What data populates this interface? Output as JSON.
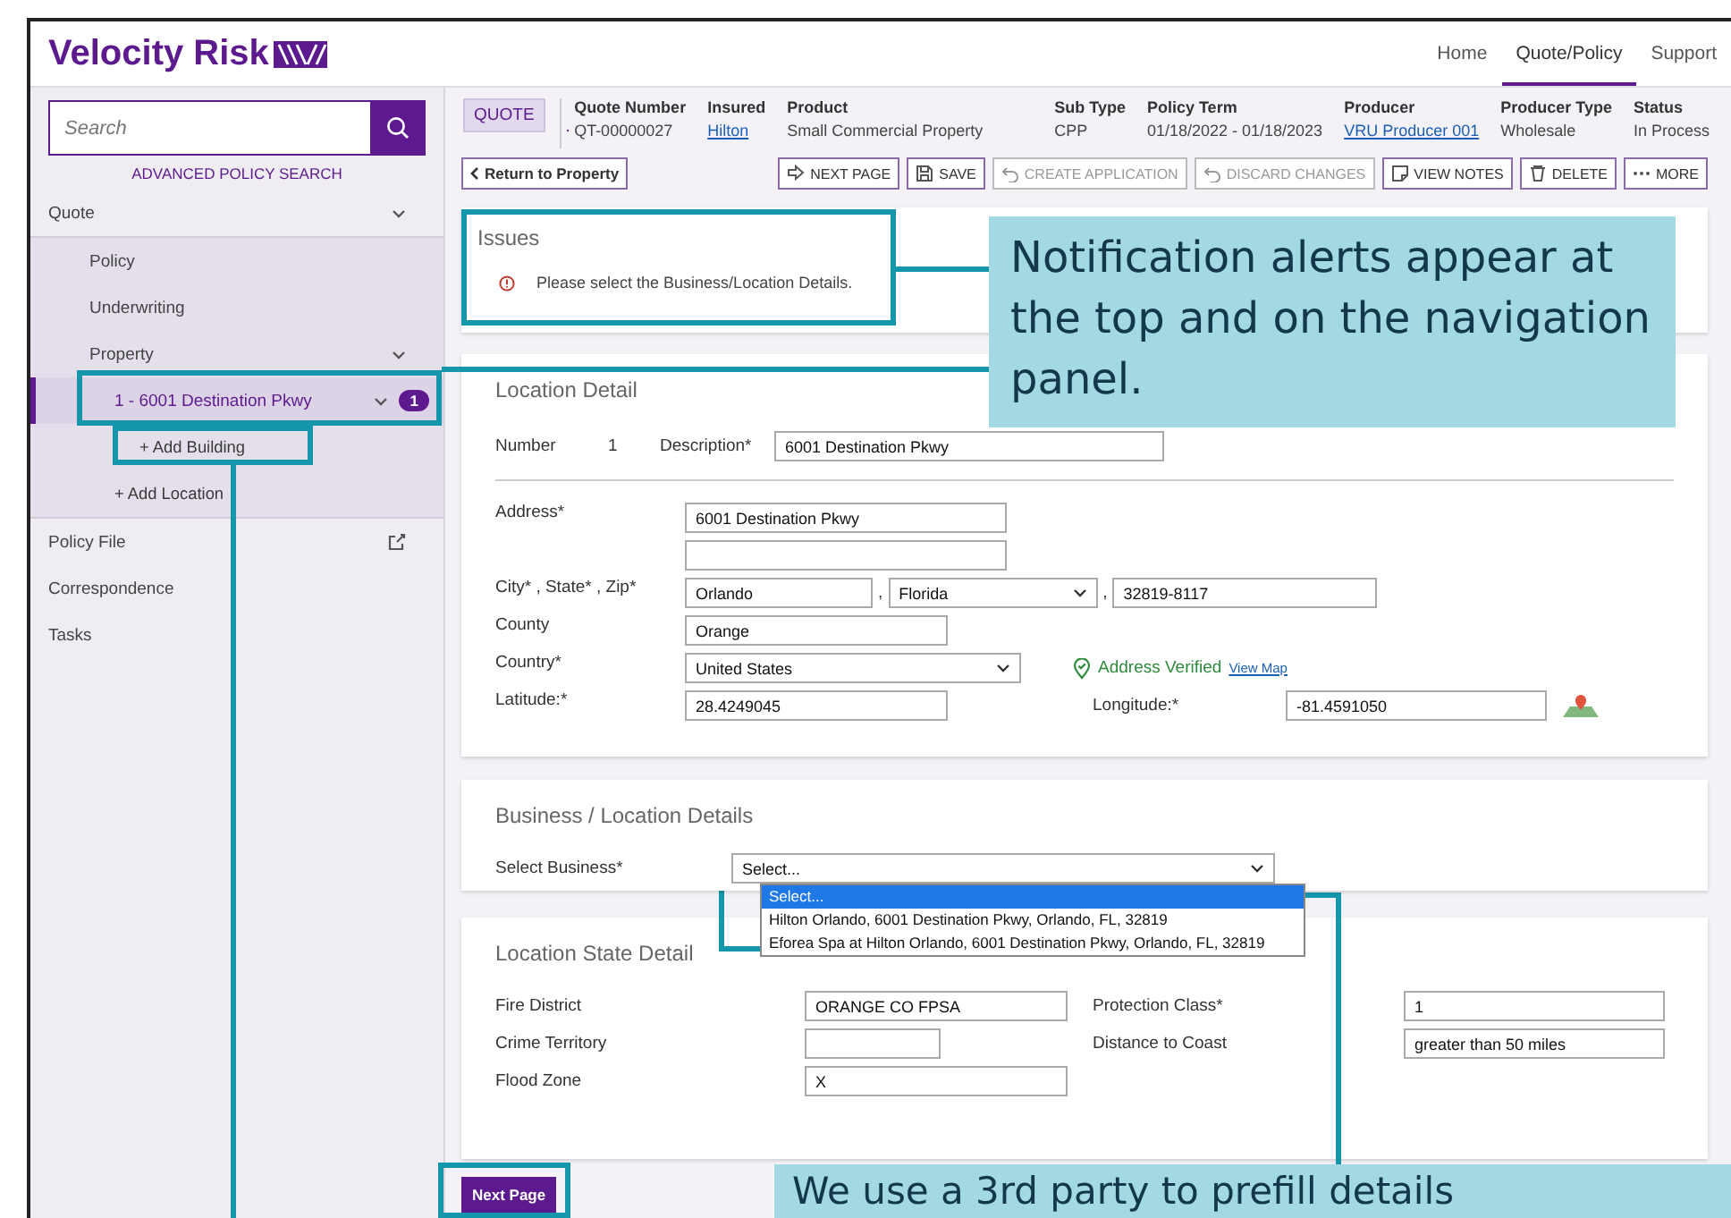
{
  "header": {
    "logo": "Velocity Risk",
    "nav": [
      {
        "label": "Home",
        "selected": false
      },
      {
        "label": "Quote/Policy",
        "selected": true
      },
      {
        "label": "Support",
        "selected": false
      }
    ]
  },
  "sidebar": {
    "search": {
      "placeholder": "Search"
    },
    "advanced_search": "ADVANCED POLICY SEARCH",
    "items": [
      {
        "label": "Quote",
        "kind": "group",
        "expanded": true,
        "selected": false,
        "children": [
          {
            "label": "Policy",
            "kind": "link",
            "selected": false
          },
          {
            "label": "Underwriting",
            "kind": "link",
            "selected": false
          },
          {
            "label": "Property",
            "kind": "group",
            "expanded": true,
            "selected": false,
            "children": [
              {
                "label": "1 - 6001 Destination Pkwy",
                "kind": "group",
                "expanded": true,
                "selected": true,
                "badge": "1",
                "children": [
                  {
                    "label": "+ Add Building",
                    "kind": "add",
                    "selected": false
                  }
                ]
              },
              {
                "label": "+ Add Location",
                "kind": "add",
                "selected": false
              }
            ]
          }
        ]
      },
      {
        "label": "Policy File",
        "kind": "external",
        "selected": false
      },
      {
        "label": "Correspondence",
        "kind": "link",
        "selected": false
      },
      {
        "label": "Tasks",
        "kind": "link",
        "selected": false
      }
    ]
  },
  "quote_bar": {
    "badge": "QUOTE",
    "fields": [
      {
        "label": "Quote Number",
        "value": "QT-00000027",
        "link": false
      },
      {
        "label": "Insured",
        "value": "Hilton",
        "link": true
      },
      {
        "label": "Product",
        "value": "Small Commercial Property",
        "link": false
      },
      {
        "label": "Sub Type",
        "value": "CPP",
        "link": false
      },
      {
        "label": "Policy Term",
        "value": "01/18/2022 - 01/18/2023",
        "link": false
      },
      {
        "label": "Producer",
        "value": "VRU Producer 001",
        "link": true
      },
      {
        "label": "Producer Type",
        "value": "Wholesale",
        "link": false
      },
      {
        "label": "Status",
        "value": "In Process",
        "link": false
      }
    ]
  },
  "toolbar": {
    "back": "Return to Property",
    "actions": [
      {
        "label": "NEXT PAGE",
        "kind": "arrow",
        "disabled": false
      },
      {
        "label": "SAVE",
        "kind": "disk",
        "disabled": false
      },
      {
        "label": "CREATE APPLICATION",
        "kind": "undo",
        "disabled": true
      },
      {
        "label": "DISCARD CHANGES",
        "kind": "undo",
        "disabled": true
      },
      {
        "label": "VIEW NOTES",
        "kind": "note",
        "disabled": false
      },
      {
        "label": "DELETE",
        "kind": "trash",
        "disabled": false
      },
      {
        "label": "MORE",
        "kind": "dots",
        "disabled": false
      }
    ]
  },
  "issues": {
    "title": "Issues",
    "messages": [
      "Please select the Business/Location Details."
    ]
  },
  "location_detail": {
    "title": "Location Detail",
    "number_label": "Number",
    "number": "1",
    "description_label": "Description*",
    "description": "6001 Destination Pkwy",
    "address_label": "Address*",
    "address": "6001 Destination Pkwy",
    "city_label": "City* , State* , Zip*",
    "city": "Orlando",
    "city_separators": [
      ",",
      ","
    ],
    "state": "Florida",
    "zip": "32819-8117",
    "county_label": "County",
    "county": "Orange",
    "country_label": "Country*",
    "country": "United States",
    "verified": "Address Verified",
    "map_link": "View Map",
    "latitude_label": "Latitude:*",
    "latitude": "28.4249045",
    "longitude_label": "Longitude:*",
    "longitude": "-81.4591050"
  },
  "business": {
    "title": "Business / Location Details",
    "label": "Select Business*",
    "value": "Select...",
    "options": [
      {
        "label": "Select...",
        "selected": true
      },
      {
        "label": "Hilton Orlando, 6001 Destination Pkwy, Orlando, FL, 32819",
        "selected": false
      },
      {
        "label": "Eforea Spa at Hilton Orlando, 6001 Destination Pkwy, Orlando, FL, 32819",
        "selected": false
      }
    ]
  },
  "state_detail": {
    "title": "Location State Detail",
    "fields": [
      {
        "label": "Fire District",
        "value": "ORANGE CO FPSA"
      },
      {
        "label": "Protection Class*",
        "value": "1"
      },
      {
        "label": "Crime Territory"
      },
      {
        "label": "Distance to Coast",
        "value": "greater than 50 miles"
      },
      {
        "label": "Flood Zone",
        "value": "X"
      }
    ]
  },
  "next_button": "Next Page",
  "annotations": [
    {
      "text": "Notification alerts appear at the top and on the navigation panel."
    },
    {
      "text": "We use a 3rd party to prefill details"
    }
  ]
}
